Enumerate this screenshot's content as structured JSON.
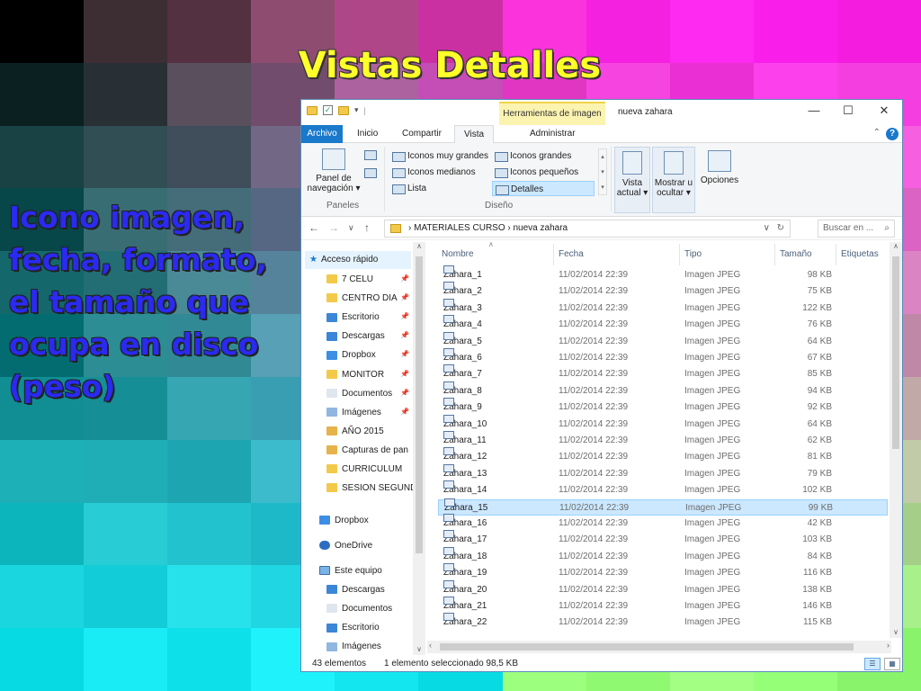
{
  "slide": {
    "title": "Vistas Detalles",
    "text": "Icono imagen, fecha, formato, el tamaño que ocupa en disco (peso)"
  },
  "colors": {
    "title": "#ffff2a",
    "text": "#2a2af0",
    "file_tab": "#1979ca",
    "selection": "#cce8ff"
  },
  "window": {
    "context_tab": "Herramientas de imagen",
    "title": "nueva zahara",
    "minimize": "—",
    "maximize": "☐",
    "close": "✕",
    "tabs": [
      "Archivo",
      "Inicio",
      "Compartir",
      "Vista",
      "Administrar"
    ]
  },
  "ribbon": {
    "panes": {
      "label": "Panel de navegación",
      "group": "Paneles"
    },
    "layout": {
      "group": "Diseño",
      "items": [
        "Iconos muy grandes",
        "Iconos grandes",
        "Iconos medianos",
        "Iconos pequeños",
        "Lista",
        "Detalles"
      ]
    },
    "current_view": "Vista actual",
    "show_hide": "Mostrar u ocultar",
    "options": "Opciones"
  },
  "address": {
    "path": [
      "MATERIALES CURSO",
      "nueva zahara"
    ],
    "search_placeholder": "Buscar en ..."
  },
  "nav_pane": {
    "quick_access": "Acceso rápido",
    "items": [
      "7 CELU",
      "CENTRO DIA",
      "Escritorio",
      "Descargas",
      "Dropbox",
      "MONITOR",
      "Documentos",
      "Imágenes",
      "AÑO 2015",
      "Capturas de pan",
      "CURRICULUM",
      "SESION SEGUND"
    ],
    "dropbox": "Dropbox",
    "onedrive": "OneDrive",
    "this_pc": "Este equipo",
    "pc_items": [
      "Descargas",
      "Documentos",
      "Escritorio",
      "Imágenes"
    ]
  },
  "columns": [
    "Nombre",
    "Fecha",
    "Tipo",
    "Tamaño",
    "Etiquetas"
  ],
  "files": [
    {
      "name": "Zahara_1",
      "date": "11/02/2014 22:39",
      "type": "Imagen JPEG",
      "size": "98 KB"
    },
    {
      "name": "Zahara_2",
      "date": "11/02/2014 22:39",
      "type": "Imagen JPEG",
      "size": "75 KB"
    },
    {
      "name": "Zahara_3",
      "date": "11/02/2014 22:39",
      "type": "Imagen JPEG",
      "size": "122 KB"
    },
    {
      "name": "Zahara_4",
      "date": "11/02/2014 22:39",
      "type": "Imagen JPEG",
      "size": "76 KB"
    },
    {
      "name": "Zahara_5",
      "date": "11/02/2014 22:39",
      "type": "Imagen JPEG",
      "size": "64 KB"
    },
    {
      "name": "Zahara_6",
      "date": "11/02/2014 22:39",
      "type": "Imagen JPEG",
      "size": "67 KB"
    },
    {
      "name": "Zahara_7",
      "date": "11/02/2014 22:39",
      "type": "Imagen JPEG",
      "size": "85 KB"
    },
    {
      "name": "Zahara_8",
      "date": "11/02/2014 22:39",
      "type": "Imagen JPEG",
      "size": "94 KB"
    },
    {
      "name": "Zahara_9",
      "date": "11/02/2014 22:39",
      "type": "Imagen JPEG",
      "size": "92 KB"
    },
    {
      "name": "Zahara_10",
      "date": "11/02/2014 22:39",
      "type": "Imagen JPEG",
      "size": "64 KB"
    },
    {
      "name": "Zahara_11",
      "date": "11/02/2014 22:39",
      "type": "Imagen JPEG",
      "size": "62 KB"
    },
    {
      "name": "Zahara_12",
      "date": "11/02/2014 22:39",
      "type": "Imagen JPEG",
      "size": "81 KB"
    },
    {
      "name": "Zahara_13",
      "date": "11/02/2014 22:39",
      "type": "Imagen JPEG",
      "size": "79 KB"
    },
    {
      "name": "Zahara_14",
      "date": "11/02/2014 22:39",
      "type": "Imagen JPEG",
      "size": "102 KB"
    },
    {
      "name": "Zahara_15",
      "date": "11/02/2014 22:39",
      "type": "Imagen JPEG",
      "size": "99 KB",
      "selected": true
    },
    {
      "name": "Zahara_16",
      "date": "11/02/2014 22:39",
      "type": "Imagen JPEG",
      "size": "42 KB"
    },
    {
      "name": "Zahara_17",
      "date": "11/02/2014 22:39",
      "type": "Imagen JPEG",
      "size": "103 KB"
    },
    {
      "name": "Zahara_18",
      "date": "11/02/2014 22:39",
      "type": "Imagen JPEG",
      "size": "84 KB"
    },
    {
      "name": "Zahara_19",
      "date": "11/02/2014 22:39",
      "type": "Imagen JPEG",
      "size": "116 KB"
    },
    {
      "name": "Zahara_20",
      "date": "11/02/2014 22:39",
      "type": "Imagen JPEG",
      "size": "138 KB"
    },
    {
      "name": "Zahara_21",
      "date": "11/02/2014 22:39",
      "type": "Imagen JPEG",
      "size": "146 KB"
    },
    {
      "name": "Zahara_22",
      "date": "11/02/2014 22:39",
      "type": "Imagen JPEG",
      "size": "115 KB"
    }
  ],
  "status": {
    "count": "43 elementos",
    "selection": "1 elemento seleccionado 98,5 KB"
  }
}
